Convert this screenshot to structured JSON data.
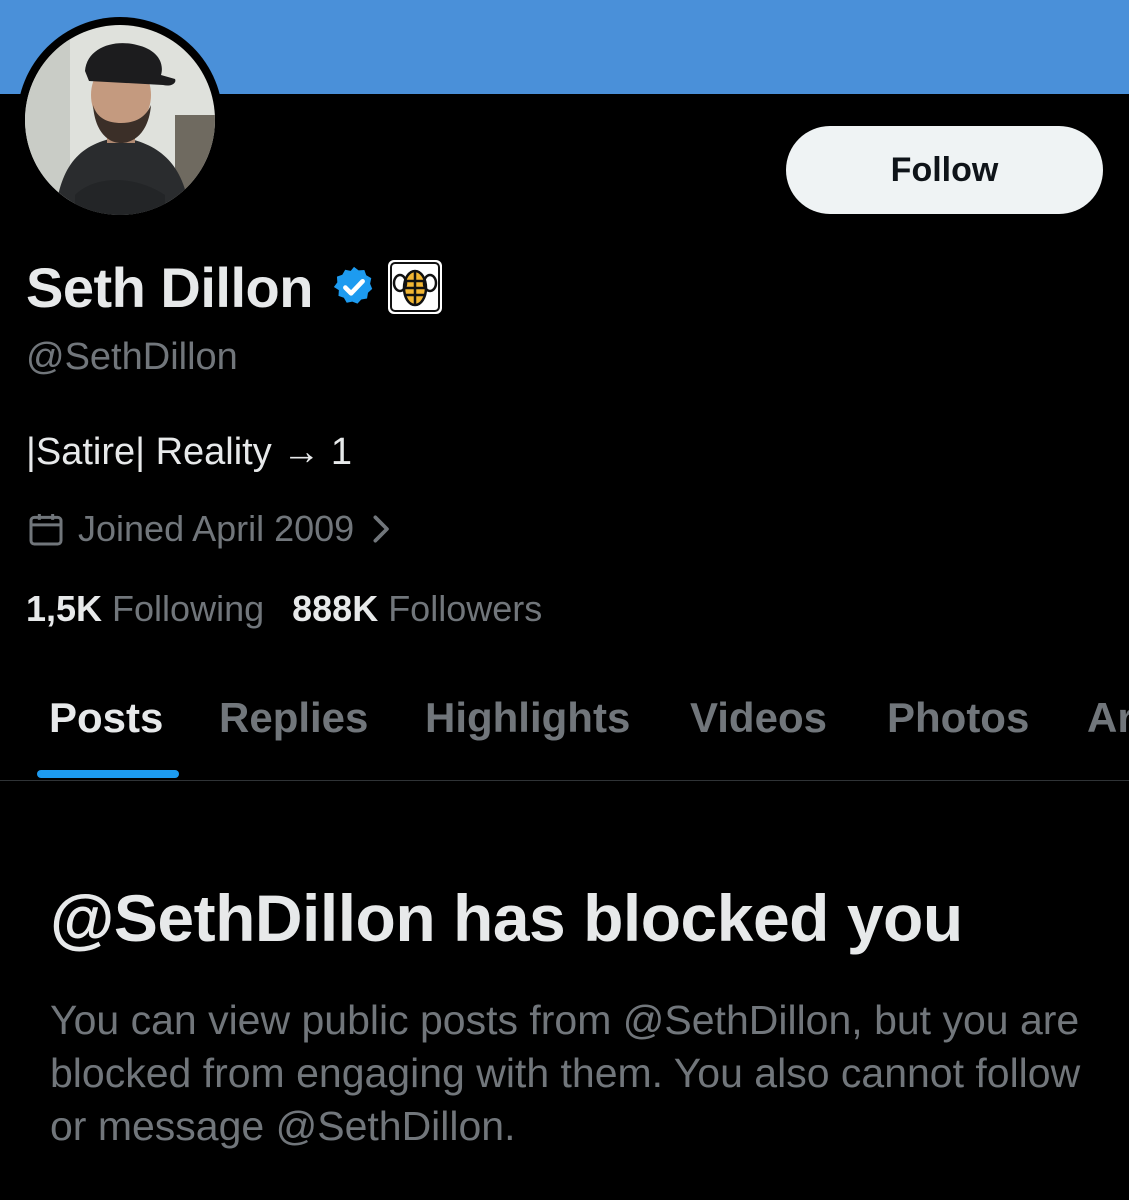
{
  "profile": {
    "display_name": "Seth Dillon",
    "handle": "@SethDillon",
    "bio": "|Satire| Reality → 1",
    "joined": "Joined April 2009",
    "following_count": "1,5K",
    "following_label": "Following",
    "followers_count": "888K",
    "followers_label": "Followers"
  },
  "actions": {
    "follow_label": "Follow"
  },
  "tabs": [
    {
      "label": "Posts",
      "active": true
    },
    {
      "label": "Replies"
    },
    {
      "label": "Highlights"
    },
    {
      "label": "Videos"
    },
    {
      "label": "Photos"
    },
    {
      "label": "Ar"
    }
  ],
  "blocked": {
    "title": "@SethDillon has blocked you",
    "body": "You can view public posts from @SethDillon, but you are blocked from engaging with them. You also cannot follow or message @SethDillon."
  },
  "icons": {
    "verified": "verified-badge-icon",
    "affiliate": "babylon-bee-affiliate-icon",
    "calendar": "calendar-icon",
    "chevron": "chevron-right-icon"
  },
  "colors": {
    "banner": "#4a90d9",
    "accent": "#1d9bf0",
    "background": "#000000",
    "text_primary": "#e7e9ea",
    "text_secondary": "#71767b"
  }
}
